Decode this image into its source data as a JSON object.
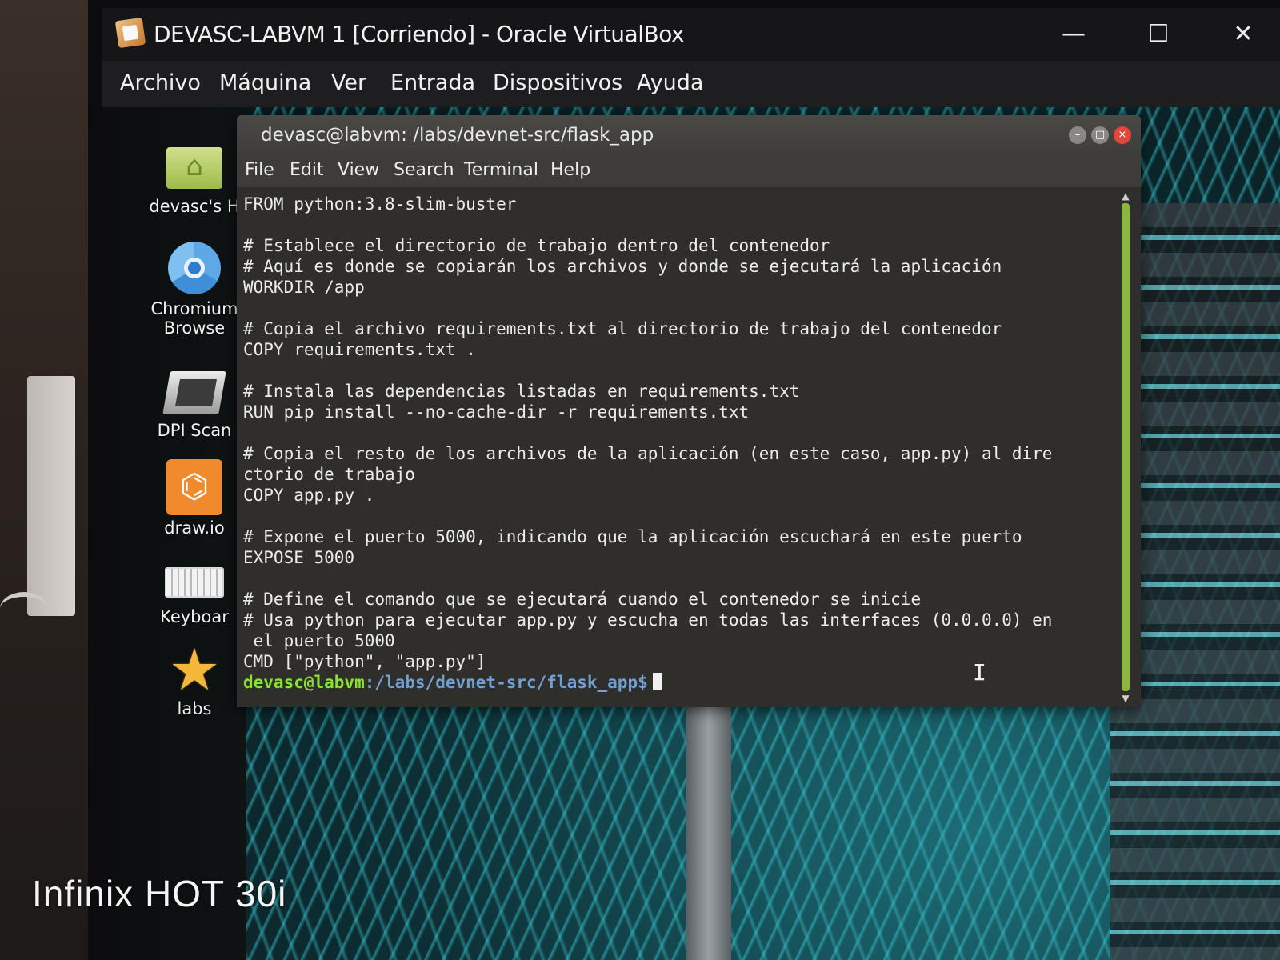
{
  "window": {
    "title": "DEVASC-LABVM 1 [Corriendo] - Oracle VirtualBox",
    "minimize": "—",
    "maximize": "☐",
    "close": "✕"
  },
  "menubar": {
    "items": [
      "Archivo",
      "Máquina",
      "Ver",
      "Entrada",
      "Dispositivos",
      "Ayuda"
    ]
  },
  "desktop": {
    "icons": [
      {
        "label": "devasc's H",
        "icon": "home-folder-icon"
      },
      {
        "label": "Chromium",
        "label2": "Browse",
        "icon": "chromium-icon"
      },
      {
        "label": "DPI Scan",
        "icon": "scanner-icon"
      },
      {
        "label": "draw.io",
        "icon": "drawio-icon"
      },
      {
        "label": "Keyboar",
        "icon": "keyboard-icon"
      },
      {
        "label": "labs",
        "icon": "star-icon"
      }
    ]
  },
  "terminal": {
    "title": "devasc@labvm: /labs/devnet-src/flask_app",
    "menu": [
      "File",
      "Edit",
      "View",
      "Search",
      "Terminal",
      "Help"
    ],
    "lines": [
      "FROM python:3.8-slim-buster",
      "",
      "# Establece el directorio de trabajo dentro del contenedor",
      "# Aquí es donde se copiarán los archivos y donde se ejecutará la aplicación",
      "WORKDIR /app",
      "",
      "# Copia el archivo requirements.txt al directorio de trabajo del contenedor",
      "COPY requirements.txt .",
      "",
      "# Instala las dependencias listadas en requirements.txt",
      "RUN pip install --no-cache-dir -r requirements.txt",
      "",
      "# Copia el resto de los archivos de la aplicación (en este caso, app.py) al dire",
      "ctorio de trabajo",
      "COPY app.py .",
      "",
      "# Expone el puerto 5000, indicando que la aplicación escuchará en este puerto",
      "EXPOSE 5000",
      "",
      "# Define el comando que se ejecutará cuando el contenedor se inicie",
      "# Usa python para ejecutar app.py y escucha en todas las interfaces (0.0.0.0) en",
      " el puerto 5000",
      "CMD [\"python\", \"app.py\"]"
    ],
    "prompt_user": "devasc@labvm",
    "prompt_path": ":/labs/devnet-src/flask_app$"
  },
  "watermark": "Infinix HOT 30i",
  "colors": {
    "prompt_user": "#8ae234",
    "prompt_path": "#729fcf",
    "scrollbar": "#8bb83c",
    "close_button": "#e0463a"
  }
}
